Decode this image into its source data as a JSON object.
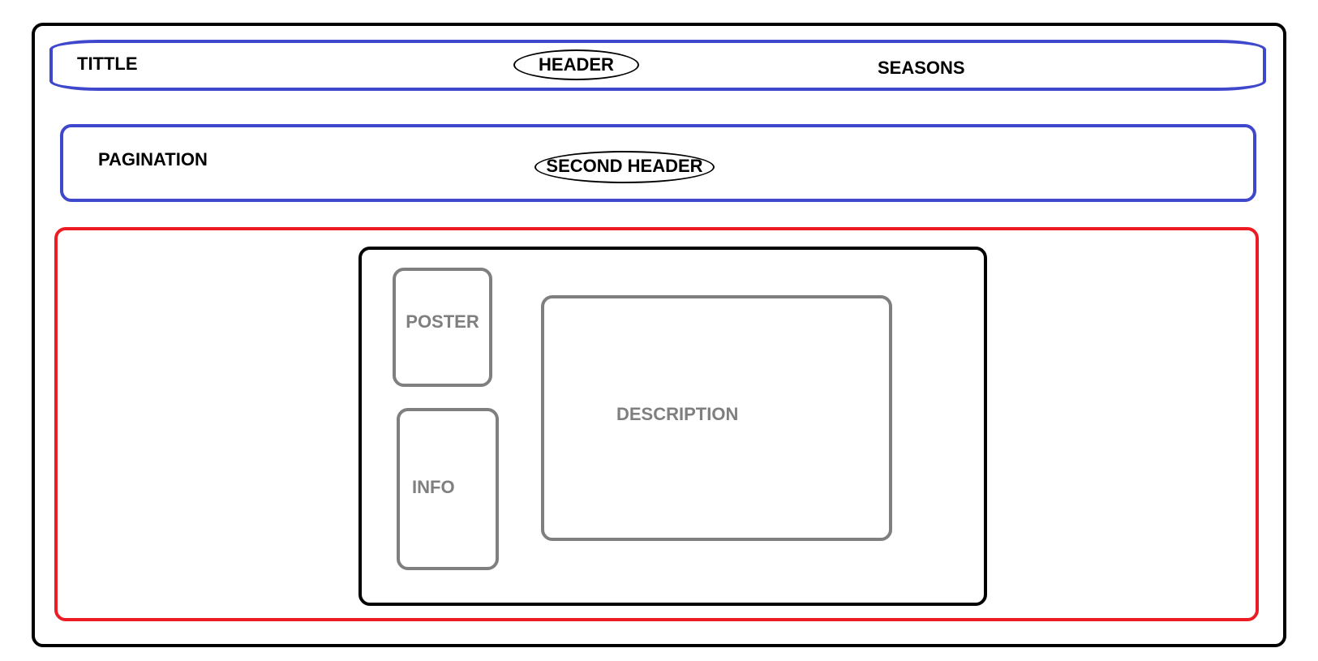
{
  "labels": {
    "title": "TITTLE",
    "header": "HEADER",
    "seasons": "SEASONS",
    "pagination": "PAGINATION",
    "second_header": "SECOND HEADER",
    "poster": "POSTER",
    "info": "INFO",
    "description": "DESCRIPTION"
  },
  "colors": {
    "outer_border": "#000000",
    "header_border": "#3f48cc",
    "second_header_border": "#3f48cc",
    "content_border": "#ed1c24",
    "card_border": "#000000",
    "inner_box_border": "#7f7f7f",
    "inner_label": "#7f7f7f",
    "dark_label": "#000000"
  }
}
